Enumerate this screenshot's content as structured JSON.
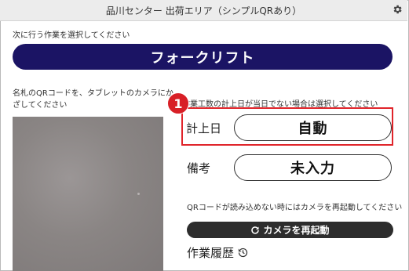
{
  "header": {
    "title": "品川センター 出荷エリア（シンプルQRあり）",
    "settings_icon": "gear-icon"
  },
  "task": {
    "instruction": "次に行う作業を選択してください",
    "selected_label": "フォークリフト"
  },
  "scan": {
    "instruction": "名札のQRコードを、タブレットのカメラにかざしてください"
  },
  "form": {
    "instruction": "作業工数の計上日が当日でない場合は選択してください",
    "badge": "1",
    "date_label": "計上日",
    "date_value": "自動",
    "note_label": "備考",
    "note_value": "未入力"
  },
  "camera_help": {
    "instruction": "QRコードが読み込めない時にはカメラを再起動してください",
    "restart_label": "カメラを再起動",
    "restart_icon": "refresh-icon"
  },
  "history": {
    "label": "作業履歴",
    "icon": "history-icon"
  },
  "colors": {
    "primary": "#1b1464",
    "highlight": "#e0242a",
    "dark_button": "#2d2d2d"
  }
}
